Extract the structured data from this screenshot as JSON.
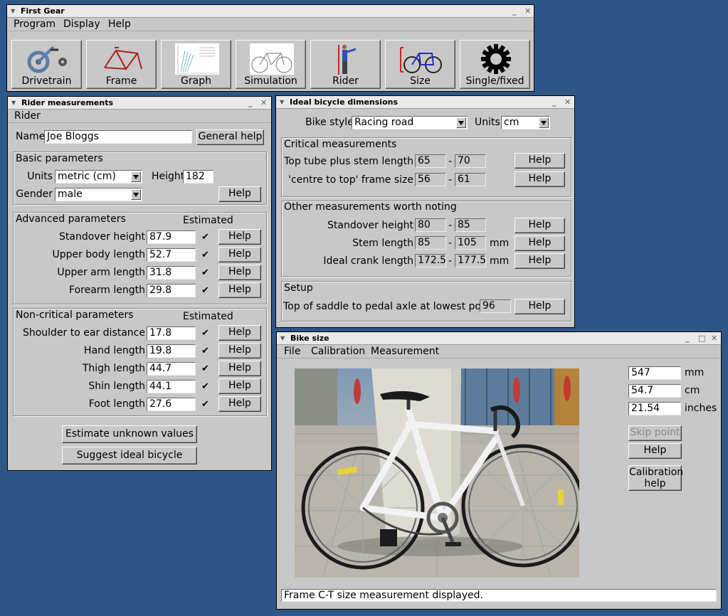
{
  "main": {
    "title": "First Gear",
    "menu": [
      "Program",
      "Display",
      "Help"
    ],
    "toolbar": [
      "Drivetrain",
      "Frame",
      "Graph",
      "Simulation",
      "Rider",
      "Size",
      "Single/fixed"
    ]
  },
  "rider": {
    "title": "Rider measurements",
    "menu": [
      "Rider"
    ],
    "name_label": "Name",
    "name_value": "Joe Bloggs",
    "general_help": "General help",
    "basic": {
      "title": "Basic parameters",
      "units_label": "Units",
      "units_value": "metric (cm)",
      "height_label": "Height",
      "height_value": "182",
      "gender_label": "Gender",
      "gender_value": "male",
      "help": "Help"
    },
    "advanced": {
      "title": "Advanced parameters",
      "estimated": "Estimated",
      "rows": [
        {
          "label": "Standover height",
          "value": "87.9",
          "check": "✔",
          "help": "Help"
        },
        {
          "label": "Upper body length",
          "value": "52.7",
          "check": "✔",
          "help": "Help"
        },
        {
          "label": "Upper arm length",
          "value": "31.8",
          "check": "✔",
          "help": "Help"
        },
        {
          "label": "Forearm length",
          "value": "29.8",
          "check": "✔",
          "help": "Help"
        }
      ]
    },
    "noncritical": {
      "title": "Non-critical parameters",
      "estimated": "Estimated",
      "rows": [
        {
          "label": "Shoulder to ear distance",
          "value": "17.8",
          "check": "✔",
          "help": "Help"
        },
        {
          "label": "Hand length",
          "value": "19.8",
          "check": "✔",
          "help": "Help"
        },
        {
          "label": "Thigh length",
          "value": "44.7",
          "check": "✔",
          "help": "Help"
        },
        {
          "label": "Shin length",
          "value": "44.1",
          "check": "✔",
          "help": "Help"
        },
        {
          "label": "Foot length",
          "value": "27.6",
          "check": "✔",
          "help": "Help"
        }
      ]
    },
    "estimate_btn": "Estimate unknown values",
    "suggest_btn": "Suggest ideal bicycle"
  },
  "ideal": {
    "title": "Ideal bicycle dimensions",
    "style_label": "Bike style",
    "style_value": "Racing road",
    "units_label": "Units",
    "units_value": "cm",
    "critical": {
      "title": "Critical measurements",
      "rows": [
        {
          "label": "Top tube plus stem length",
          "min": "65",
          "dash": "-",
          "max": "70",
          "unit": "",
          "help": "Help"
        },
        {
          "label": "'centre to top' frame size",
          "min": "56",
          "dash": "-",
          "max": "61",
          "unit": "",
          "help": "Help"
        }
      ]
    },
    "other": {
      "title": "Other measurements worth noting",
      "rows": [
        {
          "label": "Standover height",
          "min": "80",
          "dash": "-",
          "max": "85",
          "unit": "",
          "help": "Help"
        },
        {
          "label": "Stem length",
          "min": "85",
          "dash": "-",
          "max": "105",
          "unit": "mm",
          "help": "Help"
        },
        {
          "label": "Ideal crank length",
          "min": "172.5",
          "dash": "-",
          "max": "177.5",
          "unit": "mm",
          "help": "Help"
        }
      ]
    },
    "setup": {
      "title": "Setup",
      "label": "Top of saddle to pedal axle at lowest point",
      "value": "96",
      "help": "Help"
    }
  },
  "bikesize": {
    "title": "Bike size",
    "menu": [
      "File",
      "Calibration",
      "Measurement"
    ],
    "mm_value": "547",
    "mm_unit": "mm",
    "cm_value": "54.7",
    "cm_unit": "cm",
    "in_value": "21.54",
    "in_unit": "inches",
    "skip_point": "Skip point",
    "help": "Help",
    "calib_help_1": "Calibration",
    "calib_help_2": "help",
    "status": "Frame C-T size measurement displayed."
  },
  "colors": {
    "desktop": "#2e5788",
    "window": "#c8c8c8",
    "bike_frame": "#ffffff"
  }
}
